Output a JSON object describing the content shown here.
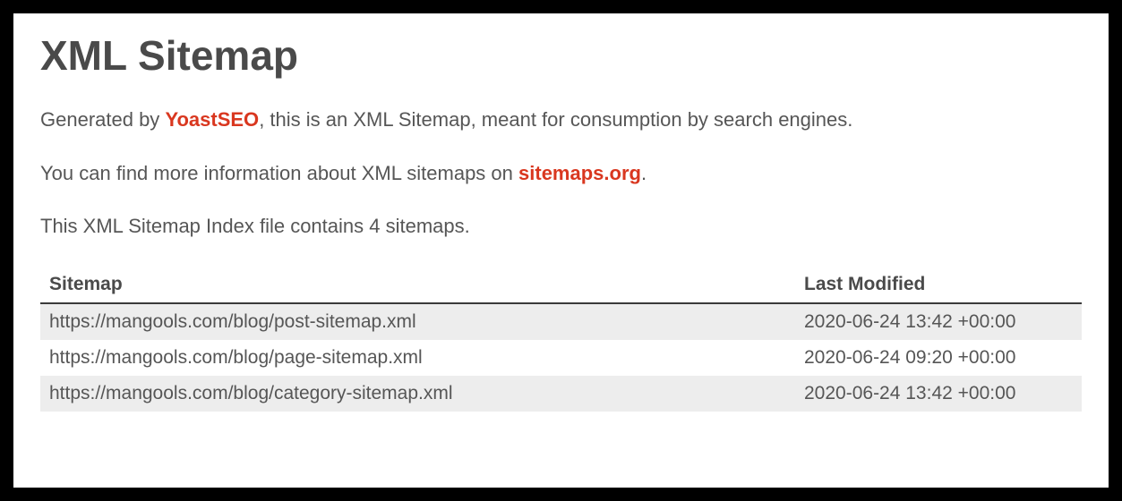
{
  "title": "XML Sitemap",
  "intro": {
    "p1_a": "Generated by ",
    "p1_link": "YoastSEO",
    "p1_b": ", this is an XML Sitemap, meant for consumption by search engines.",
    "p2_a": "You can find more information about XML sitemaps on ",
    "p2_link": "sitemaps.org",
    "p2_b": ".",
    "p3": "This XML Sitemap Index file contains 4 sitemaps."
  },
  "table": {
    "headers": {
      "sitemap": "Sitemap",
      "last_modified": "Last Modified"
    },
    "rows": [
      {
        "sitemap": "https://mangools.com/blog/post-sitemap.xml",
        "last_modified": "2020-06-24 13:42 +00:00"
      },
      {
        "sitemap": "https://mangools.com/blog/page-sitemap.xml",
        "last_modified": "2020-06-24 09:20 +00:00"
      },
      {
        "sitemap": "https://mangools.com/blog/category-sitemap.xml",
        "last_modified": "2020-06-24 13:42 +00:00"
      }
    ]
  }
}
